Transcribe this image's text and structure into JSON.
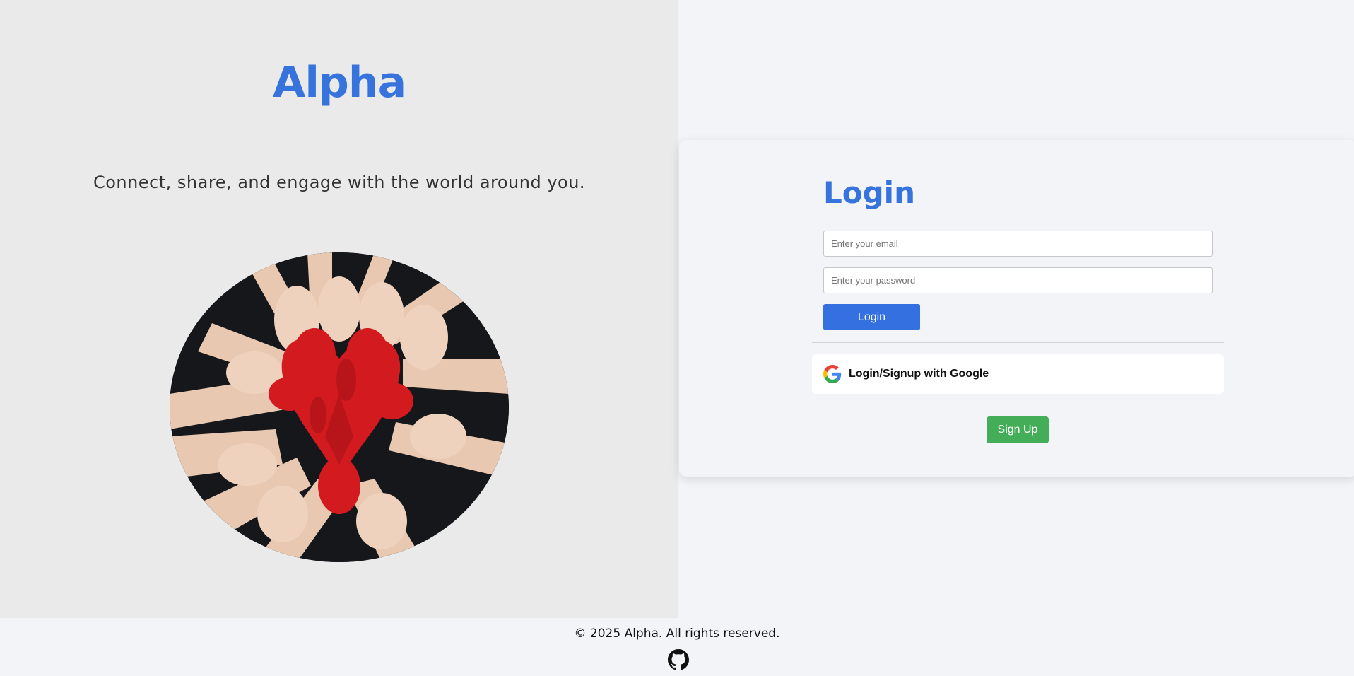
{
  "brand": {
    "name": "Alpha",
    "tagline": "Connect, share, and engage with the world around you."
  },
  "hero": {
    "image": "painted-red-hands-circle"
  },
  "login": {
    "title": "Login",
    "email_placeholder": "Enter your email",
    "password_placeholder": "Enter your password",
    "login_label": "Login",
    "google_label": "Login/Signup with Google",
    "signup_label": "Sign Up"
  },
  "footer": {
    "copyright": "© 2025 Alpha. All rights reserved.",
    "icon": "github-icon"
  },
  "colors": {
    "brand_blue": "#3673dc",
    "login_button": "#3470e0",
    "signup_button": "#43ad57",
    "left_bg": "#eaeaea",
    "page_bg": "#f3f4f7"
  }
}
